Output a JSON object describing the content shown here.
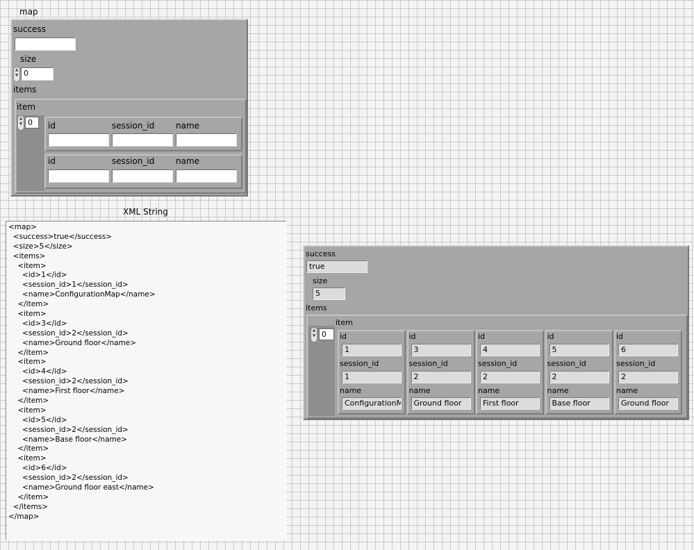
{
  "map_control": {
    "title": "map",
    "success_label": "success",
    "success_value": "",
    "size_label": "size",
    "size_value": "0",
    "items_label": "items",
    "item_label": "item",
    "item_index": "0",
    "rows": [
      {
        "id_label": "id",
        "session_id_label": "session_id",
        "name_label": "name",
        "id": "",
        "session_id": "",
        "name": ""
      },
      {
        "id_label": "id",
        "session_id_label": "session_id",
        "name_label": "name",
        "id": "",
        "session_id": "",
        "name": ""
      }
    ]
  },
  "xml_string": {
    "label": "XML String",
    "lines": [
      "<map>",
      "  <success>true</success>",
      "  <size>5</size>",
      "  <items>",
      "    <item>",
      "      <id>1</id>",
      "      <session_id>1</session_id>",
      "      <name>ConfigurationMap</name>",
      "    </item>",
      "    <item>",
      "      <id>3</id>",
      "      <session_id>2</session_id>",
      "      <name>Ground floor</name>",
      "    </item>",
      "    <item>",
      "      <id>4</id>",
      "      <session_id>2</session_id>",
      "      <name>First floor</name>",
      "    </item>",
      "    <item>",
      "      <id>5</id>",
      "      <session_id>2</session_id>",
      "      <name>Base floor</name>",
      "    </item>",
      "    <item>",
      "      <id>6</id>",
      "      <session_id>2</session_id>",
      "      <name>Ground floor east</name>",
      "    </item>",
      "  </items>",
      "</map>"
    ]
  },
  "map_indicator": {
    "success_label": "success",
    "success_value": "true",
    "size_label": "size",
    "size_value": "5",
    "items_label": "items",
    "item_label": "item",
    "item_index": "0",
    "columns": [
      {
        "id_label": "id",
        "id": "1",
        "session_id_label": "session_id",
        "session_id": "1",
        "name_label": "name",
        "name": "ConfigurationMap"
      },
      {
        "id_label": "id",
        "id": "3",
        "session_id_label": "session_id",
        "session_id": "2",
        "name_label": "name",
        "name": "Ground floor"
      },
      {
        "id_label": "id",
        "id": "4",
        "session_id_label": "session_id",
        "session_id": "2",
        "name_label": "name",
        "name": "First floor"
      },
      {
        "id_label": "id",
        "id": "5",
        "session_id_label": "session_id",
        "session_id": "2",
        "name_label": "name",
        "name": "Base floor"
      },
      {
        "id_label": "id",
        "id": "6",
        "session_id_label": "session_id",
        "session_id": "2",
        "name_label": "name",
        "name": "Ground floor"
      }
    ]
  },
  "icons": {
    "spinner": "increment-decrement-icon"
  },
  "colors": {
    "panel_bg": "#f4f4f4",
    "cluster": "#a6a6a6",
    "control_bg": "#ffffff",
    "indicator_bg": "#dcdcdc"
  }
}
